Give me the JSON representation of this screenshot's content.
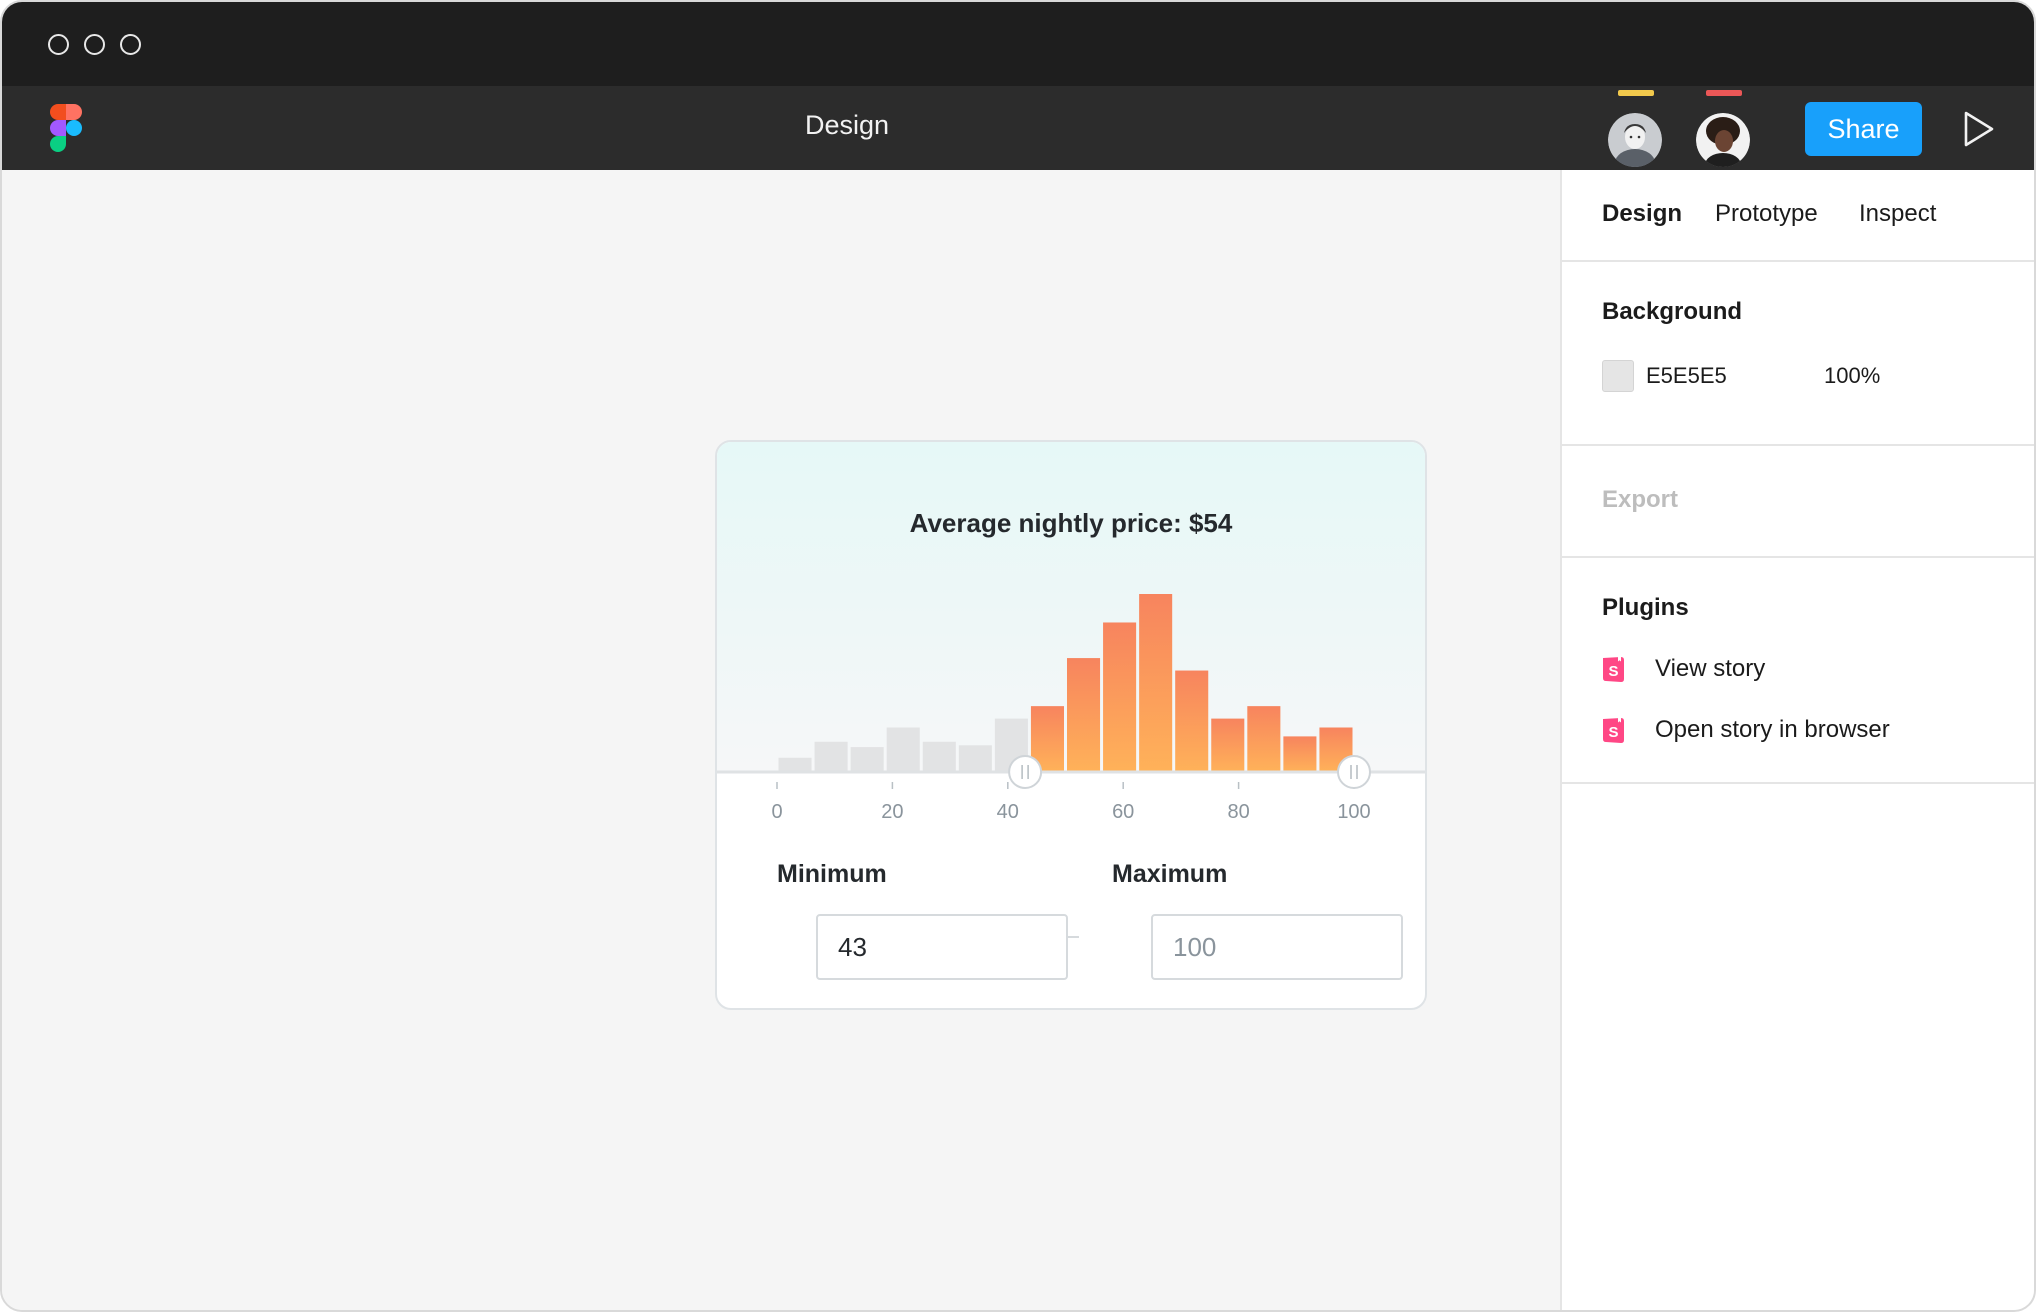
{
  "window": {
    "traffic_lights": [
      "close",
      "minimize",
      "maximize"
    ]
  },
  "toolbar": {
    "title": "Design",
    "share_label": "Share",
    "collaborators": [
      {
        "name": "avatar-user-1",
        "color": "#f2c94c"
      },
      {
        "name": "avatar-user-2",
        "color": "#eb5757"
      }
    ],
    "accent": "#18a0fb"
  },
  "panel": {
    "tabs": [
      {
        "label": "Design",
        "active": true
      },
      {
        "label": "Prototype",
        "active": false
      },
      {
        "label": "Inspect",
        "active": false
      }
    ],
    "background": {
      "title": "Background",
      "hex": "E5E5E5",
      "opacity": "100%"
    },
    "export": {
      "title": "Export"
    },
    "plugins": {
      "title": "Plugins",
      "items": [
        {
          "label": "View story",
          "icon": "storybook-icon"
        },
        {
          "label": "Open story in browser",
          "icon": "storybook-icon"
        }
      ]
    }
  },
  "card": {
    "title": "Average nightly price: $54",
    "min_label": "Minimum",
    "max_label": "Maximum",
    "min_value": "43",
    "max_placeholder": "100",
    "colors": {
      "selected_top": "#f7845e",
      "selected_bottom": "#ffb259",
      "unselected": "#e2e3e4"
    }
  },
  "chart_data": {
    "type": "bar",
    "title": "Average nightly price: $54",
    "xlabel": "",
    "ylabel": "",
    "x_ticks": [
      "0",
      "20",
      "40",
      "60",
      "80",
      "100"
    ],
    "xlim": [
      0,
      100
    ],
    "bin_width": 6.25,
    "values": [
      8,
      17,
      14,
      25,
      17,
      15,
      30,
      37,
      64,
      84,
      100,
      57,
      30,
      37,
      20,
      25
    ],
    "selected_range": [
      43,
      100
    ],
    "grid": false,
    "legend": "none"
  }
}
